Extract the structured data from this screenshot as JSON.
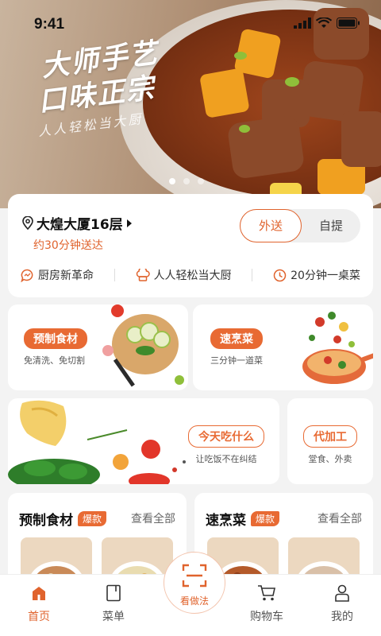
{
  "status_bar": {
    "time": "9:41"
  },
  "banner": {
    "line1": "大师手艺",
    "line2": "口味正宗",
    "tagline": "人人轻松当大厨",
    "slide_count": 3,
    "active_slide": 1
  },
  "delivery": {
    "location": "大煌大厦16层",
    "eta": "约30分钟送达",
    "mode_options": [
      "外送",
      "自提"
    ],
    "selected_mode": "外送",
    "features": [
      "厨房新革命",
      "人人轻松当大厨",
      "20分钟一桌菜"
    ]
  },
  "categories": [
    {
      "tag": "预制食材",
      "desc": "免清洗、免切割"
    },
    {
      "tag": "速烹菜",
      "desc": "三分钟一道菜"
    },
    {
      "tag": "今天吃什么",
      "desc": "让吃饭不在纠结"
    },
    {
      "tag": "代加工",
      "desc": "堂食、外卖"
    }
  ],
  "sections": [
    {
      "title": "预制食材",
      "badge": "爆款",
      "more": "查看全部"
    },
    {
      "title": "速烹菜",
      "badge": "爆款",
      "more": "查看全部"
    }
  ],
  "tabbar": {
    "items": [
      "首页",
      "菜单",
      "购物车",
      "我的"
    ],
    "active": "首页",
    "center_label": "看做法"
  },
  "colors": {
    "accent": "#e86a33",
    "accent_text": "#e0632d"
  }
}
